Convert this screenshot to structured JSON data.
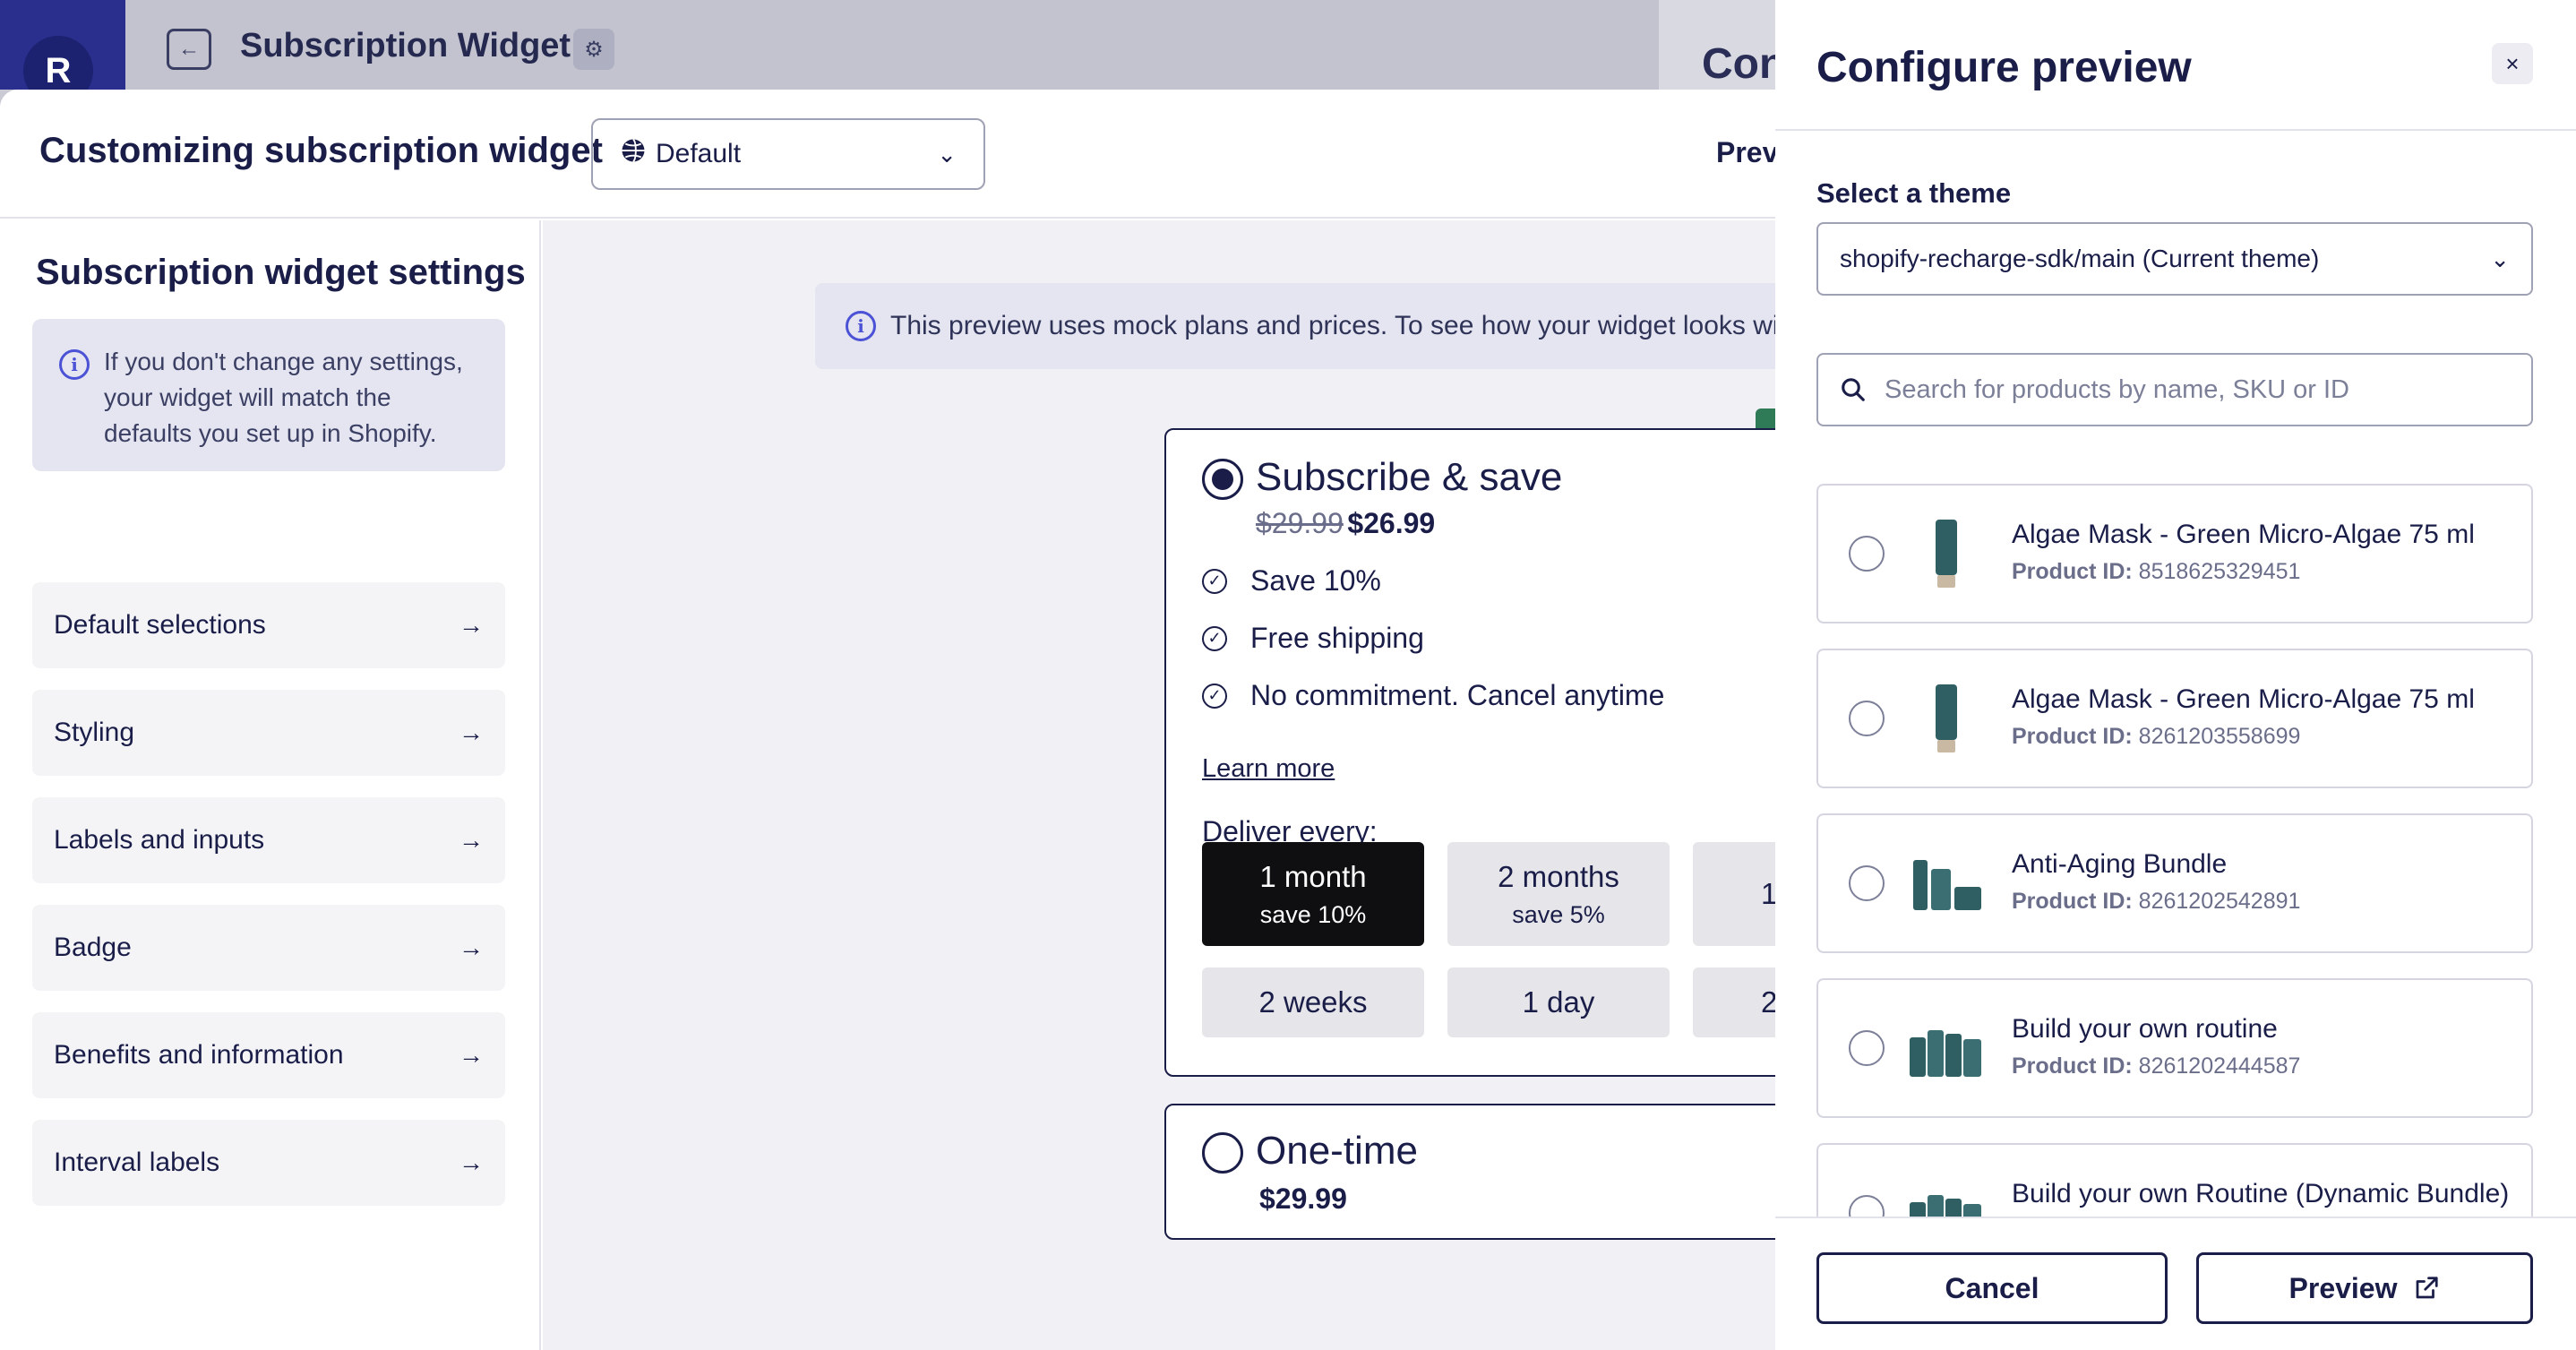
{
  "app": {
    "title": "Subscription Widget",
    "logo_letter": "R",
    "back_icon": "arrow-left-icon",
    "settings_icon": "gear-icon",
    "background_heading": "Con"
  },
  "modal": {
    "title": "Customizing subscription widget",
    "locale_select": {
      "value": "Default",
      "icon": "globe-icon"
    },
    "preview_label": "Previ"
  },
  "settings": {
    "title": "Subscription widget settings",
    "info": "If you don't change any settings, your widget will match the defaults you set up in Shopify.",
    "items": [
      {
        "label": "Default selections"
      },
      {
        "label": "Styling"
      },
      {
        "label": "Labels and inputs"
      },
      {
        "label": "Badge"
      },
      {
        "label": "Benefits and information"
      },
      {
        "label": "Interval labels"
      }
    ]
  },
  "preview": {
    "notice": "This preview uses mock plans and prices. To see how your widget looks with yo",
    "subscribe": {
      "title": "Subscribe & save",
      "old_price": "$29.99",
      "new_price": "$26.99",
      "benefits": [
        "Save 10%",
        "Free shipping",
        "No commitment. Cancel anytime"
      ],
      "learn_more": "Learn more",
      "deliver_label": "Deliver every:",
      "frequencies": [
        {
          "main": "1 month",
          "sub": "save 10%",
          "selected": true
        },
        {
          "main": "2 months",
          "sub": "save 5%",
          "selected": false
        },
        {
          "main": "1",
          "sub": "",
          "selected": false
        },
        {
          "main": "2 weeks",
          "sub": "",
          "selected": false
        },
        {
          "main": "1 day",
          "sub": "",
          "selected": false
        },
        {
          "main": "2",
          "sub": "",
          "selected": false
        }
      ]
    },
    "onetime": {
      "title": "One-time",
      "price": "$29.99"
    }
  },
  "drawer": {
    "title": "Configure preview",
    "close_icon": "close-icon",
    "theme_label": "Select a theme",
    "theme_value": "shopify-recharge-sdk/main (Current theme)",
    "search_placeholder": "Search for products by name, SKU or ID",
    "id_label": "Product ID:",
    "products": [
      {
        "name": "Algae Mask - Green Micro-Algae 75 ml",
        "id": "8518625329451"
      },
      {
        "name": "Algae Mask - Green Micro-Algae 75 ml",
        "id": "8261203558699"
      },
      {
        "name": "Anti-Aging Bundle",
        "id": "8261202542891"
      },
      {
        "name": "Build your own routine",
        "id": "8261202444587"
      },
      {
        "name": "Build your own Routine (Dynamic Bundle)",
        "id": ""
      }
    ],
    "cancel_label": "Cancel",
    "preview_label": "Preview"
  },
  "colors": {
    "primary": "#191d48",
    "accent": "#4b52d6",
    "selected_frequency": "#0f0f12",
    "badge_green": "#2f7a57"
  }
}
